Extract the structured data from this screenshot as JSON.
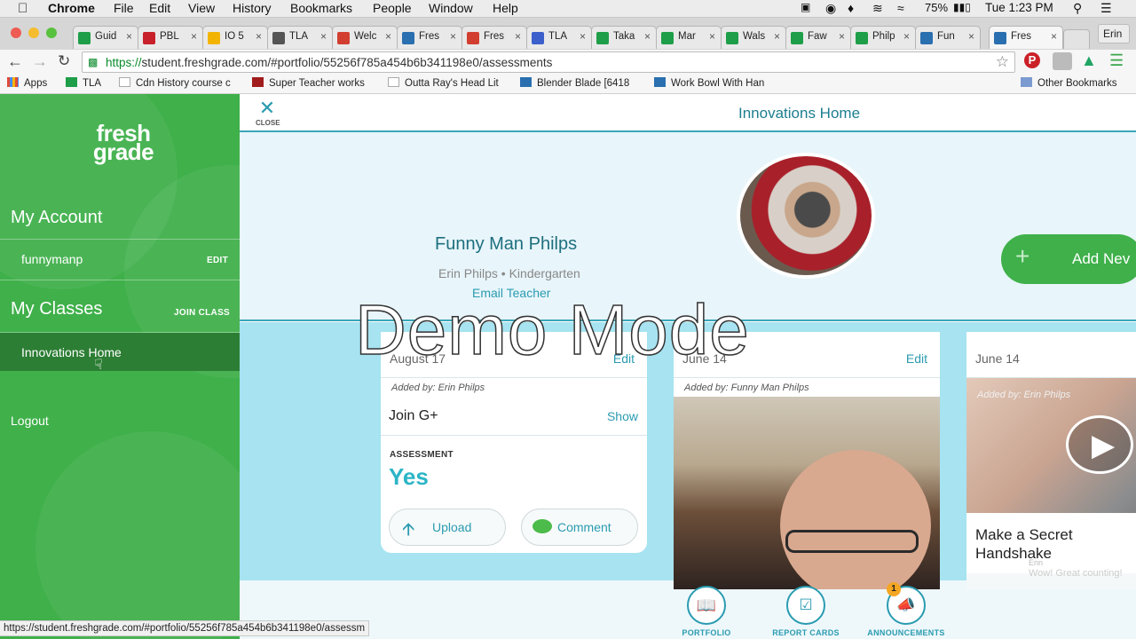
{
  "menubar": {
    "app": "Chrome",
    "items": [
      "File",
      "Edit",
      "View",
      "History",
      "Bookmarks",
      "People",
      "Window",
      "Help"
    ],
    "battery": "75%",
    "clock": "Tue 1:23 PM"
  },
  "tabs": [
    {
      "label": "Guid",
      "icon_color": "#1e9e48"
    },
    {
      "label": "PBL",
      "icon_color": "#c8202b"
    },
    {
      "label": "IO 5",
      "icon_color": "#f2b400"
    },
    {
      "label": "TLA",
      "icon_color": "#555555"
    },
    {
      "label": "Welc",
      "icon_color": "#d23f31"
    },
    {
      "label": "Fres",
      "icon_color": "#2a6fb0"
    },
    {
      "label": "Fres",
      "icon_color": "#d23f31"
    },
    {
      "label": "TLA",
      "icon_color": "#3b5fcb"
    },
    {
      "label": "Taka",
      "icon_color": "#1e9e48"
    },
    {
      "label": "Mar",
      "icon_color": "#1e9e48"
    },
    {
      "label": "Wals",
      "icon_color": "#1e9e48"
    },
    {
      "label": "Faw",
      "icon_color": "#1e9e48"
    },
    {
      "label": "Philp",
      "icon_color": "#1e9e48"
    },
    {
      "label": "Fun",
      "icon_color": "#2a6fb0"
    },
    {
      "label": "Fres",
      "icon_color": "#2a6fb0"
    }
  ],
  "profile_button": "Erin",
  "url": {
    "scheme": "https://",
    "rest": "student.freshgrade.com/#portfolio/55256f785a454b6b341198e0/assessments"
  },
  "bookmarks": [
    "Apps",
    "TLA",
    "Cdn History course c",
    "Super Teacher works",
    "Outta Ray's Head Lit",
    "Blender Blade [6418",
    "Work Bowl With Han",
    "Other Bookmarks"
  ],
  "sidebar": {
    "logo_line1": "fresh",
    "logo_line2": "grade",
    "my_account": "My Account",
    "username": "funnymanp",
    "edit": "EDIT",
    "my_classes": "My Classes",
    "join_class": "JOIN CLASS",
    "class_item": "Innovations Home",
    "logout": "Logout"
  },
  "topbar": {
    "close": "CLOSE",
    "title": "Innovations Home"
  },
  "profile": {
    "name": "Funny Man Philps",
    "sub": "Erin Philps • Kindergarten",
    "email": "Email Teacher",
    "add_new": "Add Nev"
  },
  "overlay": "Demo Mode",
  "cards": {
    "card1": {
      "date": "August 17",
      "edit": "Edit",
      "added_by": "Added by: Erin Philps",
      "title": "Join G+",
      "show": "Show",
      "assessment_label": "ASSESSMENT",
      "assessment_value": "Yes",
      "upload": "Upload",
      "comment": "Comment"
    },
    "card2": {
      "date": "June 14",
      "edit": "Edit",
      "added_by": "Added by: Funny Man Philps"
    },
    "card3": {
      "date": "June 14",
      "added_by": "Added by: Erin Philps",
      "title_line1": "Make a Secret",
      "title_line2": "Handshake",
      "comment_author": "Erin",
      "comment_text": "Wow! Great counting!"
    }
  },
  "bottom_nav": {
    "portfolio": "PORTFOLIO",
    "report_cards": "REPORT CARDS",
    "announcements": "ANNOUNCEMENTS",
    "announcement_badge": "1"
  },
  "status_url": "https://student.freshgrade.com/#portfolio/55256f785a454b6b341198e0/assessm",
  "colors": {
    "sidebar_green": "#3fb04a",
    "accent_teal": "#2a9bb0",
    "feed_bg": "#a7e3f0"
  }
}
